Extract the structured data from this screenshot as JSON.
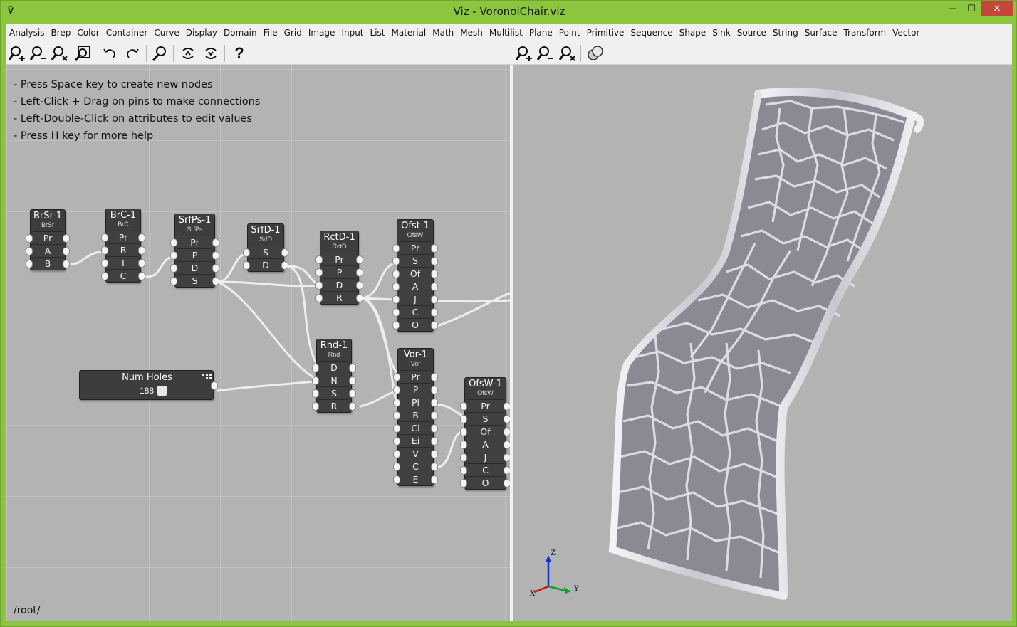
{
  "window": {
    "app_icon": "V̈",
    "title": "Viz - VoronoiChair.viz",
    "min_label": "─",
    "max_label": "☐",
    "close_label": "✕"
  },
  "menu": [
    "Analysis",
    "Brep",
    "Color",
    "Container",
    "Curve",
    "Display",
    "Domain",
    "File",
    "Grid",
    "Image",
    "Input",
    "List",
    "Material",
    "Math",
    "Mesh",
    "Multilist",
    "Plane",
    "Point",
    "Primitive",
    "Sequence",
    "Shape",
    "Sink",
    "Source",
    "String",
    "Surface",
    "Transform",
    "Vector"
  ],
  "toolbar_left": [
    "zoom-in-icon",
    "zoom-out-icon",
    "zoom-reset-icon",
    "zoom-fit-icon",
    "undo-icon",
    "redo-icon",
    "find-icon",
    "collapse-icon",
    "expand-icon",
    "help-icon"
  ],
  "toolbar_right": [
    "zoom-in-icon",
    "zoom-out-icon",
    "zoom-reset-icon",
    "shading-icon"
  ],
  "help": {
    "line1": "- Press Space key to create new nodes",
    "line2": "- Left-Click + Drag on pins to make connections",
    "line3": "- Left-Double-Click on attributes to edit values",
    "line4": "- Press H key for more help"
  },
  "path": "/root/",
  "nodes": {
    "brsr": {
      "title": "BrSr-1",
      "sub": "BrSr",
      "ports": [
        "Pr",
        "A",
        "B"
      ]
    },
    "brc": {
      "title": "BrC-1",
      "sub": "BrC",
      "ports": [
        "Pr",
        "B",
        "T",
        "C"
      ]
    },
    "srfps": {
      "title": "SrfPs-1",
      "sub": "SrfPs",
      "ports": [
        "Pr",
        "P",
        "D",
        "S"
      ]
    },
    "srfd": {
      "title": "SrfD-1",
      "sub": "SrfD",
      "ports": [
        "S",
        "D"
      ]
    },
    "rctd": {
      "title": "RctD-1",
      "sub": "RctD",
      "ports": [
        "Pr",
        "P",
        "D",
        "R"
      ]
    },
    "ofst": {
      "title": "Ofst-1",
      "sub": "OfsW",
      "ports": [
        "Pr",
        "S",
        "Of",
        "A",
        "J",
        "C",
        "O"
      ]
    },
    "rnd": {
      "title": "Rnd-1",
      "sub": "Rnd",
      "ports": [
        "D",
        "N",
        "S",
        "R"
      ]
    },
    "vor": {
      "title": "Vor-1",
      "sub": "Vor",
      "ports": [
        "Pr",
        "P",
        "Pl",
        "B",
        "Ci",
        "Ei",
        "V",
        "C",
        "E"
      ]
    },
    "ofsw": {
      "title": "OfsW-1",
      "sub": "OfsW",
      "ports": [
        "Pr",
        "S",
        "Of",
        "A",
        "J",
        "C",
        "O"
      ]
    }
  },
  "slider": {
    "title": "Num Holes",
    "value": "188"
  },
  "axes": {
    "x": "X",
    "y": "Y",
    "z": "Z"
  },
  "colors": {
    "window_frame": "#8cc63f",
    "canvas": "#b3b3b3",
    "node": "#3d3d3d",
    "close": "#c7463a",
    "axis_x": "#d01010",
    "axis_y": "#10a030",
    "axis_z": "#1030d0"
  }
}
